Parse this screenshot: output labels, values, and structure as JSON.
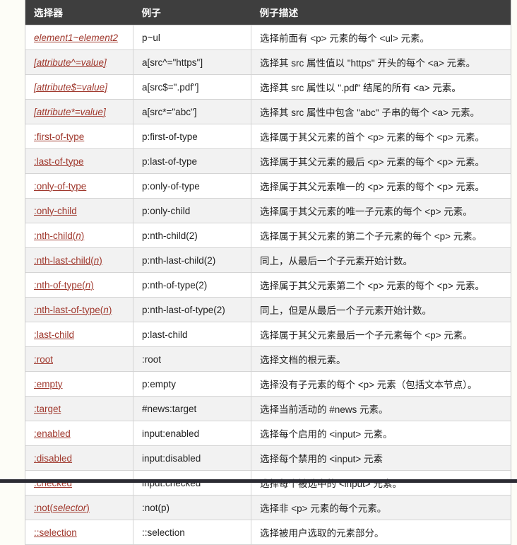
{
  "table": {
    "headers": [
      "选择器",
      "例子",
      "例子描述"
    ],
    "rows": [
      {
        "selector": "element1~element2",
        "selector_italic": "all",
        "example": "p~ul",
        "description": "选择前面有 <p> 元素的每个 <ul> 元素。"
      },
      {
        "selector": "[attribute^=value]",
        "selector_italic": "all",
        "example": "a[src^=\"https\"]",
        "description": "选择其 src 属性值以 \"https\" 开头的每个 <a> 元素。"
      },
      {
        "selector": "[attribute$=value]",
        "selector_italic": "all",
        "example": "a[src$=\".pdf\"]",
        "description": "选择其 src 属性以 \".pdf\" 结尾的所有 <a> 元素。"
      },
      {
        "selector": "[attribute*=value]",
        "selector_italic": "all",
        "example": "a[src*=\"abc\"]",
        "description": "选择其 src 属性中包含 \"abc\" 子串的每个 <a> 元素。"
      },
      {
        "selector": ":first-of-type",
        "selector_italic": "none",
        "example": "p:first-of-type",
        "description": "选择属于其父元素的首个 <p> 元素的每个 <p> 元素。"
      },
      {
        "selector": ":last-of-type",
        "selector_italic": "none",
        "example": "p:last-of-type",
        "description": "选择属于其父元素的最后 <p> 元素的每个 <p> 元素。"
      },
      {
        "selector": ":only-of-type",
        "selector_italic": "none",
        "example": "p:only-of-type",
        "description": "选择属于其父元素唯一的 <p> 元素的每个 <p> 元素。"
      },
      {
        "selector": ":only-child",
        "selector_italic": "none",
        "example": "p:only-child",
        "description": "选择属于其父元素的唯一子元素的每个 <p> 元素。"
      },
      {
        "selector": ":nth-child(n)",
        "selector_italic": "paren",
        "selector_prefix": ":nth-child(",
        "selector_em": "n",
        "selector_suffix": ")",
        "example": "p:nth-child(2)",
        "description": "选择属于其父元素的第二个子元素的每个 <p> 元素。"
      },
      {
        "selector": ":nth-last-child(n)",
        "selector_italic": "paren",
        "selector_prefix": ":nth-last-child(",
        "selector_em": "n",
        "selector_suffix": ")",
        "example": "p:nth-last-child(2)",
        "description": "同上，从最后一个子元素开始计数。"
      },
      {
        "selector": ":nth-of-type(n)",
        "selector_italic": "paren",
        "selector_prefix": ":nth-of-type(",
        "selector_em": "n",
        "selector_suffix": ")",
        "example": "p:nth-of-type(2)",
        "description": "选择属于其父元素第二个 <p> 元素的每个 <p> 元素。"
      },
      {
        "selector": ":nth-last-of-type(n)",
        "selector_italic": "paren",
        "selector_prefix": ":nth-last-of-type(",
        "selector_em": "n",
        "selector_suffix": ")",
        "example": "p:nth-last-of-type(2)",
        "description": "同上，但是从最后一个子元素开始计数。"
      },
      {
        "selector": ":last-child",
        "selector_italic": "none",
        "example": "p:last-child",
        "description": "选择属于其父元素最后一个子元素每个 <p> 元素。"
      },
      {
        "selector": ":root",
        "selector_italic": "none",
        "example": ":root",
        "description": "选择文档的根元素。"
      },
      {
        "selector": ":empty",
        "selector_italic": "none",
        "example": "p:empty",
        "description": "选择没有子元素的每个 <p> 元素（包括文本节点）。"
      },
      {
        "selector": ":target",
        "selector_italic": "none",
        "example": "#news:target",
        "description": "选择当前活动的 #news 元素。"
      },
      {
        "selector": ":enabled",
        "selector_italic": "none",
        "example": "input:enabled",
        "description": "选择每个启用的 <input> 元素。"
      },
      {
        "selector": ":disabled",
        "selector_italic": "none",
        "example": "input:disabled",
        "description": "选择每个禁用的 <input> 元素"
      },
      {
        "selector": ":checked",
        "selector_italic": "none",
        "example": "input:checked",
        "description": "选择每个被选中的 <input> 元素。"
      },
      {
        "selector": ":not(selector)",
        "selector_italic": "paren",
        "selector_prefix": ":not(",
        "selector_em": "selector",
        "selector_suffix": ")",
        "example": ":not(p)",
        "description": "选择非 <p> 元素的每个元素。"
      },
      {
        "selector": "::selection",
        "selector_italic": "none",
        "example": "::selection",
        "description": "选择被用户选取的元素部分。"
      }
    ]
  },
  "colors": {
    "header_bg": "#3E3E3E",
    "header_text": "#FFFFFF",
    "link": "#A0392E",
    "row_alt_bg": "#F2F2F2",
    "page_bg": "#FDFDF7",
    "border": "#D4D4D4",
    "bottom_bar": "#2B2B33"
  }
}
